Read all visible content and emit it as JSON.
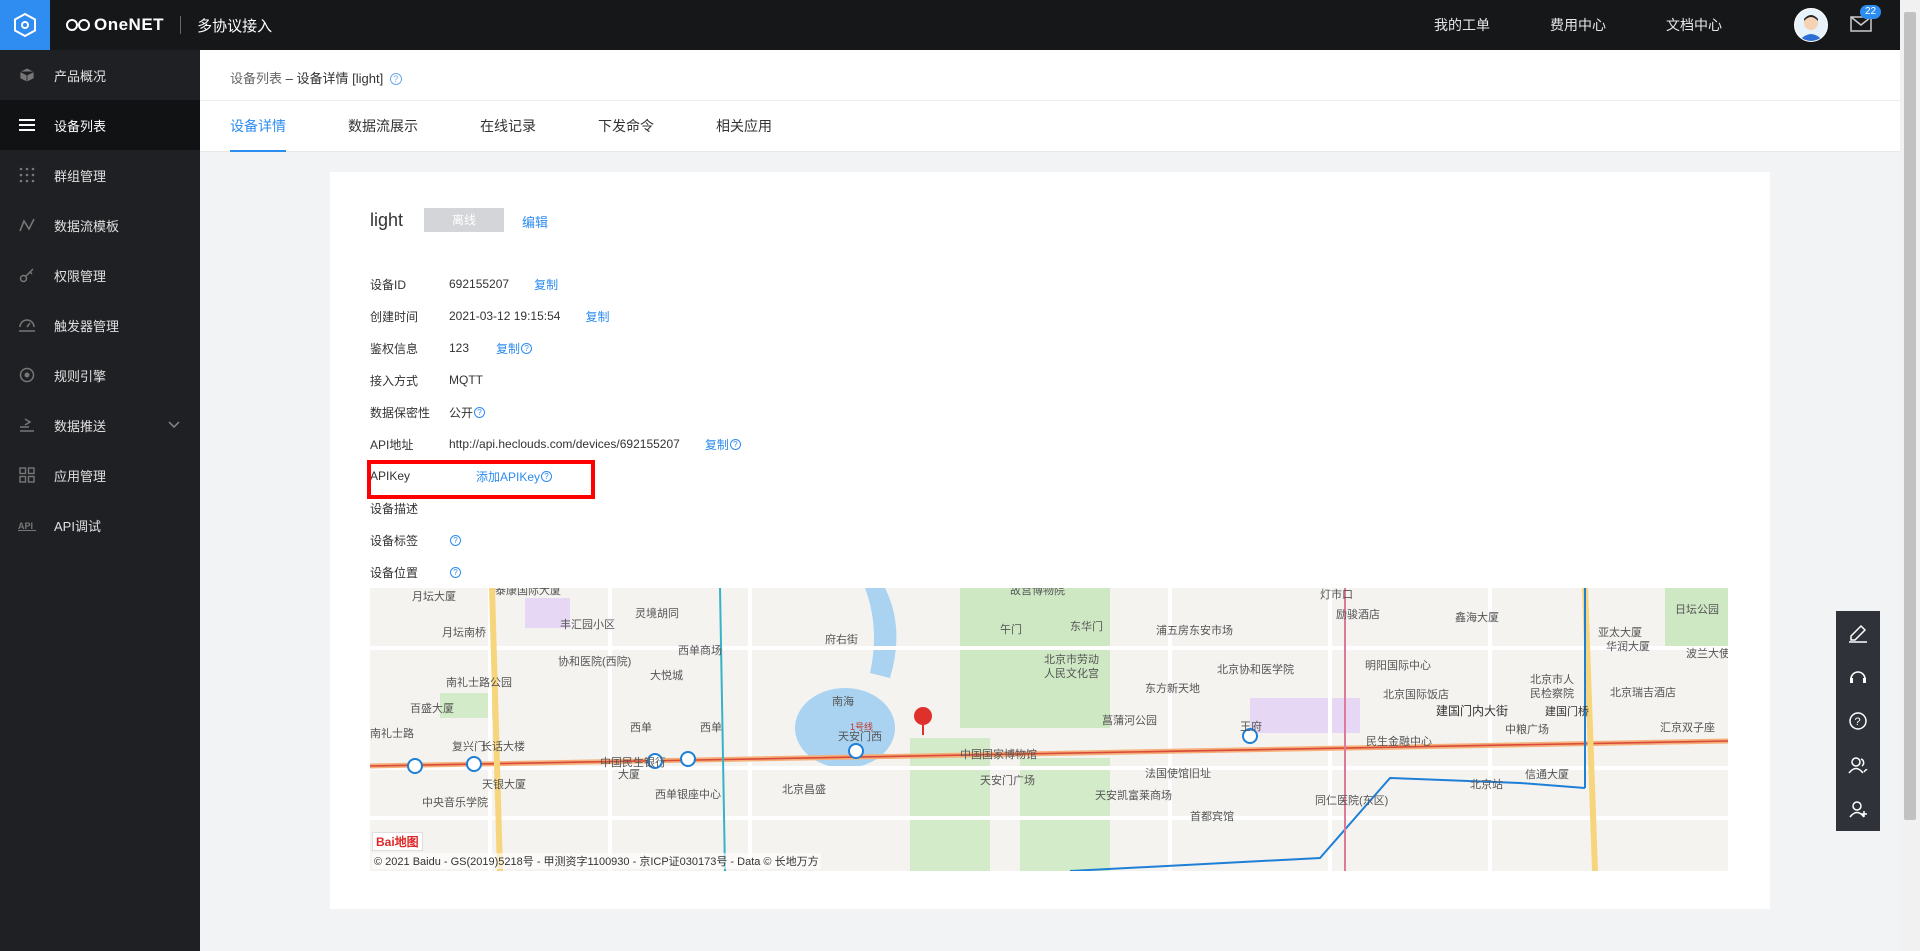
{
  "topbar": {
    "brand": "OneNET",
    "subtitle": "多协议接入",
    "links": [
      "我的工单",
      "费用中心",
      "文档中心"
    ],
    "mail_badge": "22"
  },
  "sidebar": {
    "items": [
      {
        "label": "产品概况",
        "icon": "cube-icon"
      },
      {
        "label": "设备列表",
        "icon": "list-icon",
        "active": true
      },
      {
        "label": "群组管理",
        "icon": "grid-dots-icon"
      },
      {
        "label": "数据流模板",
        "icon": "stream-icon"
      },
      {
        "label": "权限管理",
        "icon": "key-icon"
      },
      {
        "label": "触发器管理",
        "icon": "trigger-icon"
      },
      {
        "label": "规则引擎",
        "icon": "rule-icon"
      },
      {
        "label": "数据推送",
        "icon": "push-icon",
        "expandable": true
      },
      {
        "label": "应用管理",
        "icon": "apps-icon"
      },
      {
        "label": "API调试",
        "icon": "api-icon"
      }
    ]
  },
  "breadcrumb": {
    "parent": "设备列表",
    "separator": "–",
    "current": "设备详情 [light]"
  },
  "tabs": [
    "设备详情",
    "数据流展示",
    "在线记录",
    "下发命令",
    "相关应用"
  ],
  "device": {
    "name": "light",
    "status": "离线",
    "edit_label": "编辑",
    "fields": {
      "id": {
        "label": "设备ID",
        "value": "692155207",
        "action": "复制"
      },
      "created": {
        "label": "创建时间",
        "value": "2021-03-12 19:15:54",
        "action": "复制"
      },
      "auth": {
        "label": "鉴权信息",
        "value": "123",
        "action": "复制"
      },
      "access": {
        "label": "接入方式",
        "value": "MQTT"
      },
      "privacy": {
        "label": "数据保密性",
        "value": "公开"
      },
      "api": {
        "label": "API地址",
        "value": "http://api.heclouds.com/devices/692155207",
        "action": "复制"
      },
      "apikey": {
        "label": "APIKey",
        "action": "添加APIKey"
      },
      "desc": {
        "label": "设备描述"
      },
      "tags": {
        "label": "设备标签"
      },
      "location": {
        "label": "设备位置"
      }
    }
  },
  "map": {
    "copyright": "© 2021 Baidu - GS(2019)5218号 - 甲测资字1100930 - 京ICP证030173号 - Data © 长地万方",
    "logo": "Bai地图",
    "labels": [
      "月坛大厦",
      "泰康国际大厦",
      "丰汇园小区",
      "灵境胡同",
      "故宫博物院",
      "东华门",
      "灯市口",
      "励骏酒店",
      "鑫海大厦",
      "亚太大厦",
      "日坛公园",
      "月坛南桥",
      "协和医院(西院)",
      "西单商场",
      "府右街",
      "午门",
      "浦五房东安市场",
      "北京协和医学院",
      "明阳国际中心",
      "华润大厦",
      "波兰大使馆",
      "南礼士路公园",
      "大悦城",
      "北京市劳动人民文化宫",
      "东方新天地",
      "北京国际饭店",
      "北京市人民检察院",
      "北京瑞吉酒店",
      "百盛大厦",
      "南海",
      "菖蒲河公园",
      "建国门内大街",
      "建国门桥",
      "南礼士路",
      "复兴门",
      "长话大楼",
      "西单",
      "1号线",
      "天安门西",
      "王府井",
      "民生金融中心",
      "中粮广场",
      "汇京双子座",
      "中国民生银行大厦",
      "中国国家博物馆",
      "法国使馆旧址",
      "信通大厦",
      "北京站",
      "天银大厦",
      "西单银座中心",
      "北京昌盛",
      "天安门广场",
      "天安凯富莱商场",
      "同仁医院(东区)",
      "中央音乐学院",
      "首都宾馆"
    ]
  },
  "colors": {
    "accent": "#2d8cf0",
    "highlight": "#ff0000",
    "status_offline": "#d3d5d8"
  }
}
